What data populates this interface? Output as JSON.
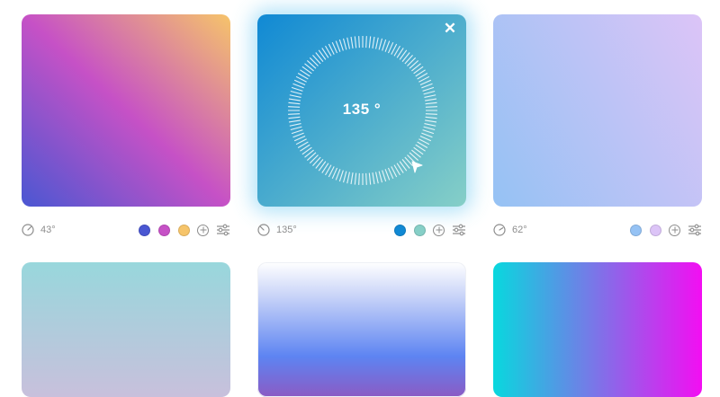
{
  "cards": [
    {
      "angle_label": "43°",
      "colors": [
        "#4a57d2",
        "#c651c6",
        "#f6c46a"
      ]
    },
    {
      "angle_label": "135°",
      "colors": [
        "#1089d4",
        "#86cfc7"
      ],
      "dial_label": "135 °",
      "close_label": "✕"
    },
    {
      "angle_label": "62°",
      "colors": [
        "#95c2f4",
        "#dcc4f7"
      ]
    },
    {
      "colors": [
        "#98d7dc",
        "#c8c0dc"
      ]
    },
    {
      "colors": [
        "#ffffff",
        "#5d84f2",
        "#8b5bc4"
      ]
    },
    {
      "colors": [
        "#08d8de",
        "#f30ef2"
      ]
    }
  ],
  "icons": {
    "angle": "gauge-icon",
    "add": "plus-circle-icon",
    "adjust": "sliders-icon",
    "close": "close-icon",
    "cursor": "pointer-cursor-icon"
  }
}
